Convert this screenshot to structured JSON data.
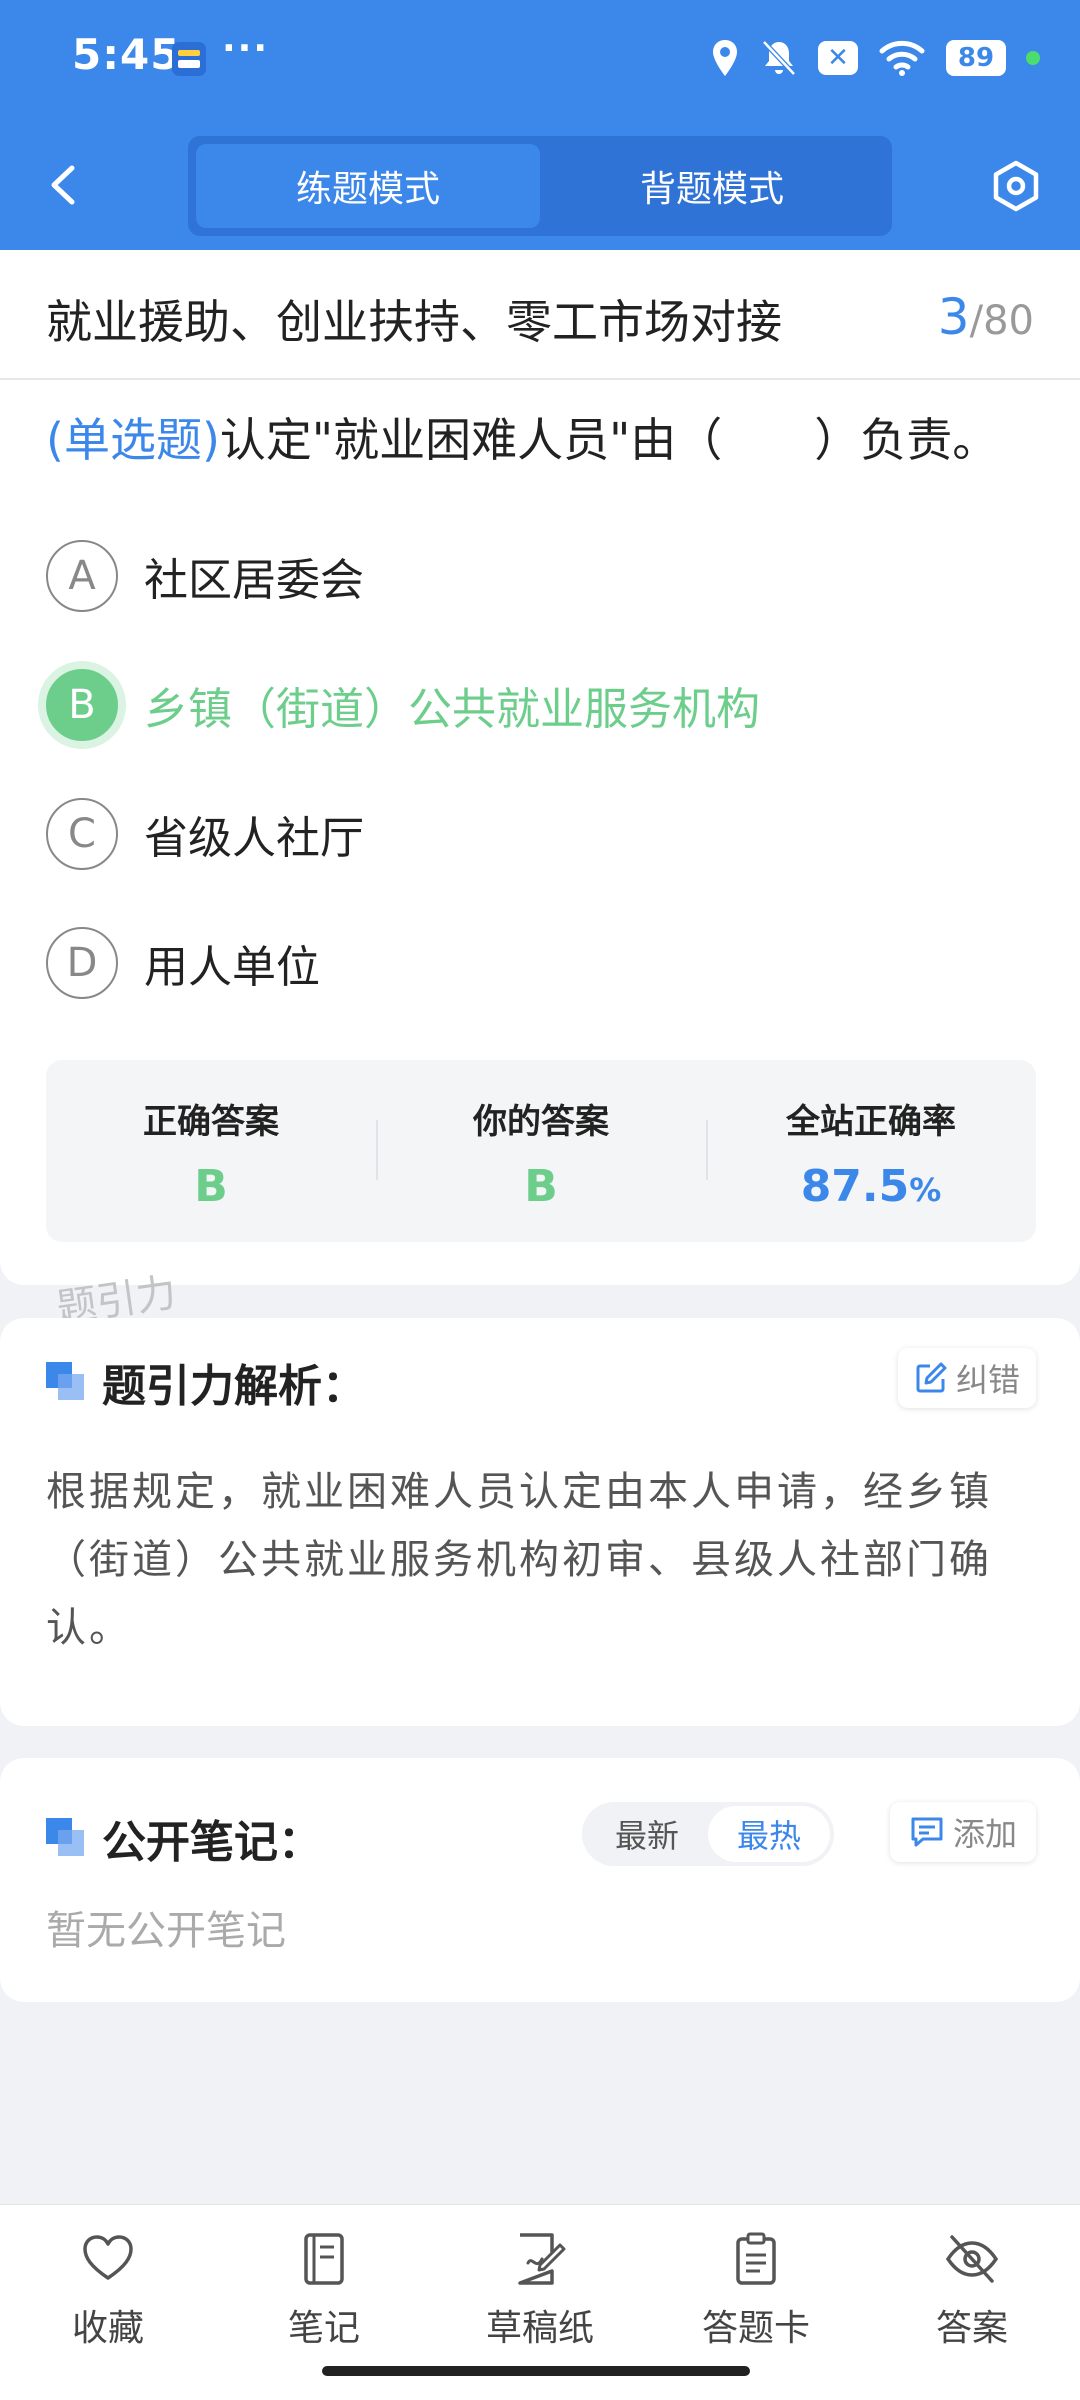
{
  "status_bar": {
    "time": "5:45",
    "more": "···",
    "battery": "89",
    "icons": [
      "wallet-app-icon",
      "location-icon",
      "bell-muted-icon",
      "x-app-icon",
      "wifi-icon",
      "battery-icon"
    ]
  },
  "header": {
    "tabs": [
      {
        "label": "练题模式",
        "active": true
      },
      {
        "label": "背题模式",
        "active": false
      }
    ]
  },
  "title_bar": {
    "chapter": "就业援助、创业扶持、零工市场对接",
    "current": "3",
    "separator": "/",
    "total": "80"
  },
  "question": {
    "type": "(单选题)",
    "text": "认定\"就业困难人员\"由（　　）负责。",
    "options": [
      {
        "letter": "A",
        "text": "社区居委会",
        "state": "normal"
      },
      {
        "letter": "B",
        "text": "乡镇（街道）公共就业服务机构",
        "state": "correct"
      },
      {
        "letter": "C",
        "text": "省级人社厅",
        "state": "normal"
      },
      {
        "letter": "D",
        "text": "用人单位",
        "state": "normal"
      }
    ]
  },
  "stats": {
    "correct_label": "正确答案",
    "correct_value": "B",
    "yours_label": "你的答案",
    "yours_value": "B",
    "rate_label": "全站正确率",
    "rate_value": "87.5",
    "rate_unit": "%"
  },
  "watermark": "题引力",
  "analysis": {
    "title": "题引力解析：",
    "report_label": "纠错",
    "text": "根据规定，就业困难人员认定由本人申请，经乡镇（街道）公共就业服务机构初审、县级人社部门确认。"
  },
  "notes": {
    "title": "公开笔记：",
    "sort_latest": "最新",
    "sort_hot": "最热",
    "add_label": "添加",
    "empty": "暂无公开笔记"
  },
  "bottom_bar": {
    "items": [
      {
        "label": "收藏",
        "icon": "heart-icon"
      },
      {
        "label": "笔记",
        "icon": "notebook-icon"
      },
      {
        "label": "草稿纸",
        "icon": "draft-paper-icon"
      },
      {
        "label": "答题卡",
        "icon": "answer-card-icon"
      },
      {
        "label": "答案",
        "icon": "eye-off-icon"
      }
    ]
  },
  "colors": {
    "primary": "#3c87ea",
    "correct": "#6dce8c",
    "background": "#f1f2f5"
  }
}
